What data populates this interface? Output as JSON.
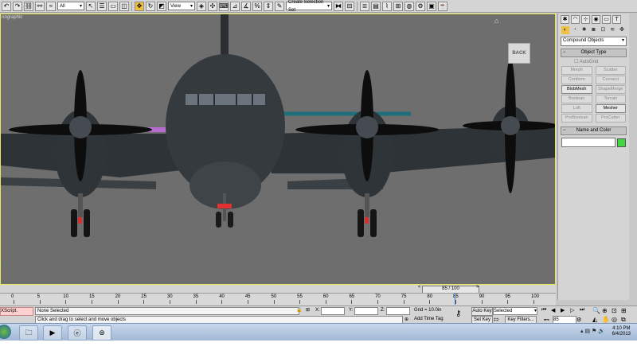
{
  "toolbar": {
    "selection_filter": "All",
    "reference_coord": "View",
    "named_selection": "Create Selection Set"
  },
  "viewport": {
    "label": "nographic",
    "viewcube_label": "BACK"
  },
  "command_panel": {
    "category": "Compound Objects",
    "object_type_title": "Object Type",
    "autogrid": "AutoGrid",
    "object_buttons": [
      {
        "label": "Morph",
        "enabled": false
      },
      {
        "label": "Scatter",
        "enabled": false
      },
      {
        "label": "Conform",
        "enabled": false
      },
      {
        "label": "Connect",
        "enabled": false
      },
      {
        "label": "BlobMesh",
        "enabled": true
      },
      {
        "label": "ShapeMerge",
        "enabled": false
      },
      {
        "label": "Boolean",
        "enabled": false
      },
      {
        "label": "Terrain",
        "enabled": false
      },
      {
        "label": "Loft",
        "enabled": false
      },
      {
        "label": "Mesher",
        "enabled": true
      },
      {
        "label": "ProBoolean",
        "enabled": false
      },
      {
        "label": "ProCutter",
        "enabled": false
      }
    ],
    "name_color_title": "Name and Color",
    "object_color": "#3fd83f"
  },
  "timeline": {
    "frame_display": "85 / 100",
    "ticks": [
      "0",
      "5",
      "10",
      "15",
      "20",
      "25",
      "30",
      "35",
      "40",
      "45",
      "50",
      "55",
      "60",
      "65",
      "70",
      "75",
      "80",
      "85",
      "90",
      "95",
      "100"
    ]
  },
  "status": {
    "maxscript": "XScript.",
    "selection": "None Selected",
    "prompt": "Click and drag to select and move objects",
    "x_label": "X:",
    "y_label": "Y:",
    "z_label": "Z:",
    "grid": "Grid = 10.0in",
    "add_time_tag": "Add Time Tag",
    "auto_key": "Auto Key",
    "set_key": "Set Key",
    "key_mode": "Selected",
    "key_filters": "Key Filters...",
    "frame": "85"
  },
  "taskbar": {
    "time": "4:10 PM",
    "date": "6/4/2013"
  }
}
